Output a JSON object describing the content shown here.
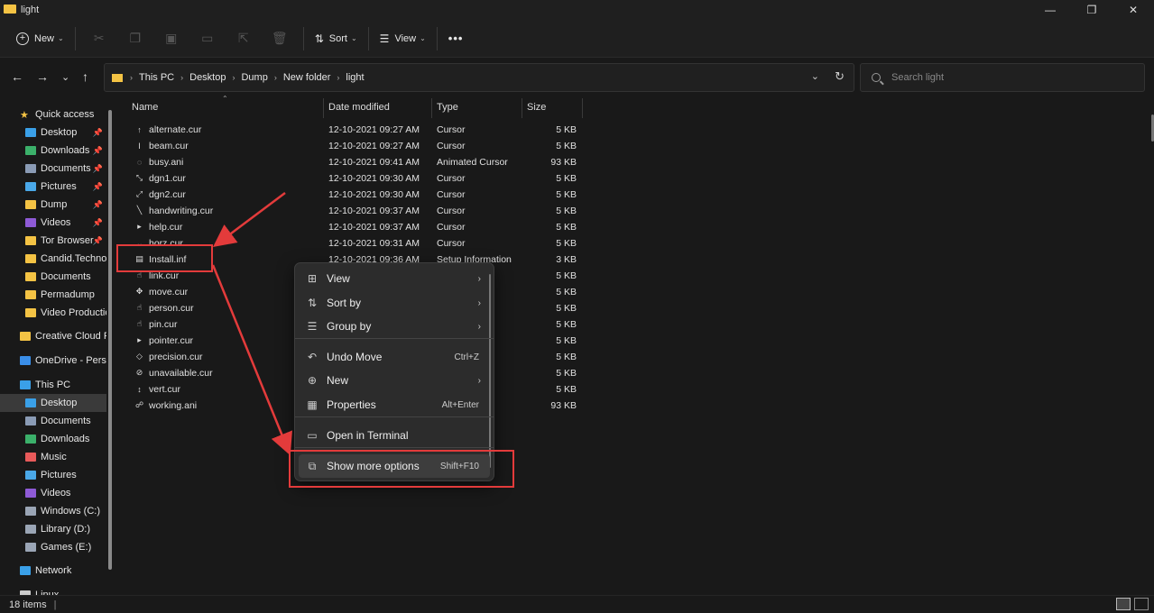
{
  "window": {
    "title": "light"
  },
  "toolbar": {
    "new_label": "New",
    "sort_label": "Sort",
    "view_label": "View",
    "more_label": "•••"
  },
  "address": {
    "crumbs": [
      "This PC",
      "Desktop",
      "Dump",
      "New folder",
      "light"
    ]
  },
  "search": {
    "placeholder": "Search light"
  },
  "sidebar": {
    "items": [
      {
        "label": "Quick access",
        "icon": "star-icon",
        "color": "#f4c344",
        "pinned": false
      },
      {
        "label": "Desktop",
        "icon": "desktop-icon",
        "color": "#3aa0e8",
        "pinned": true
      },
      {
        "label": "Downloads",
        "icon": "download-icon",
        "color": "#3bb06a",
        "pinned": true
      },
      {
        "label": "Documents",
        "icon": "documents-icon",
        "color": "#8a9bb5",
        "pinned": true
      },
      {
        "label": "Pictures",
        "icon": "pictures-icon",
        "color": "#4aa8e8",
        "pinned": true
      },
      {
        "label": "Dump",
        "icon": "folder-icon",
        "color": "#f4c344",
        "pinned": true
      },
      {
        "label": "Videos",
        "icon": "videos-icon",
        "color": "#8e5ad6",
        "pinned": true
      },
      {
        "label": "Tor Browser",
        "icon": "folder-icon",
        "color": "#f4c344",
        "pinned": true
      },
      {
        "label": "Candid.Technolo",
        "icon": "folder-icon",
        "color": "#f4c344",
        "pinned": false
      },
      {
        "label": "Documents",
        "icon": "folder-icon",
        "color": "#f4c344",
        "pinned": false
      },
      {
        "label": "Permadump",
        "icon": "folder-icon",
        "color": "#f4c344",
        "pinned": false
      },
      {
        "label": "Video Productio",
        "icon": "folder-icon",
        "color": "#f4c344",
        "pinned": false
      },
      {
        "label": "Creative Cloud Fil",
        "icon": "creative-cloud-icon",
        "color": "#f4c344",
        "pinned": false
      },
      {
        "label": "OneDrive - Persor",
        "icon": "onedrive-icon",
        "color": "#3a8ee8",
        "pinned": false
      },
      {
        "label": "This PC",
        "icon": "computer-icon",
        "color": "#3aa0e8",
        "pinned": false
      },
      {
        "label": "Desktop",
        "icon": "desktop-icon",
        "color": "#3aa0e8",
        "pinned": false
      },
      {
        "label": "Documents",
        "icon": "documents-icon",
        "color": "#8a9bb5",
        "pinned": false
      },
      {
        "label": "Downloads",
        "icon": "download-icon",
        "color": "#3bb06a",
        "pinned": false
      },
      {
        "label": "Music",
        "icon": "music-icon",
        "color": "#e85a5a",
        "pinned": false
      },
      {
        "label": "Pictures",
        "icon": "pictures-icon",
        "color": "#4aa8e8",
        "pinned": false
      },
      {
        "label": "Videos",
        "icon": "videos-icon",
        "color": "#8e5ad6",
        "pinned": false
      },
      {
        "label": "Windows (C:)",
        "icon": "drive-icon",
        "color": "#9aa5b5",
        "pinned": false
      },
      {
        "label": "Library (D:)",
        "icon": "drive-icon",
        "color": "#9aa5b5",
        "pinned": false
      },
      {
        "label": "Games (E:)",
        "icon": "drive-icon",
        "color": "#9aa5b5",
        "pinned": false
      },
      {
        "label": "Network",
        "icon": "network-icon",
        "color": "#3aa0e8",
        "pinned": false
      },
      {
        "label": "Linux",
        "icon": "linux-icon",
        "color": "#cccccc",
        "pinned": false
      }
    ],
    "selected_label": "Desktop"
  },
  "columns": {
    "name": "Name",
    "date": "Date modified",
    "type": "Type",
    "size": "Size"
  },
  "files": [
    {
      "name": "alternate.cur",
      "date": "12-10-2021 09:27 AM",
      "type": "Cursor",
      "size": "5 KB",
      "glyph": "↑"
    },
    {
      "name": "beam.cur",
      "date": "12-10-2021 09:27 AM",
      "type": "Cursor",
      "size": "5 KB",
      "glyph": "I"
    },
    {
      "name": "busy.ani",
      "date": "12-10-2021 09:41 AM",
      "type": "Animated Cursor",
      "size": "93 KB",
      "glyph": "◌"
    },
    {
      "name": "dgn1.cur",
      "date": "12-10-2021 09:30 AM",
      "type": "Cursor",
      "size": "5 KB",
      "glyph": "⤡"
    },
    {
      "name": "dgn2.cur",
      "date": "12-10-2021 09:30 AM",
      "type": "Cursor",
      "size": "5 KB",
      "glyph": "⤢"
    },
    {
      "name": "handwriting.cur",
      "date": "12-10-2021 09:37 AM",
      "type": "Cursor",
      "size": "5 KB",
      "glyph": "╲"
    },
    {
      "name": "help.cur",
      "date": "12-10-2021 09:37 AM",
      "type": "Cursor",
      "size": "5 KB",
      "glyph": "▸"
    },
    {
      "name": "horz.cur",
      "date": "12-10-2021 09:31 AM",
      "type": "Cursor",
      "size": "5 KB",
      "glyph": "↔"
    },
    {
      "name": "Install.inf",
      "date": "12-10-2021 09:36 AM",
      "type": "Setup Information",
      "size": "3 KB",
      "glyph": "▤"
    },
    {
      "name": "link.cur",
      "date": "",
      "type": "",
      "size": "5 KB",
      "glyph": "☝"
    },
    {
      "name": "move.cur",
      "date": "",
      "type": "",
      "size": "5 KB",
      "glyph": "✥"
    },
    {
      "name": "person.cur",
      "date": "",
      "type": "",
      "size": "5 KB",
      "glyph": "☝"
    },
    {
      "name": "pin.cur",
      "date": "",
      "type": "",
      "size": "5 KB",
      "glyph": "☝"
    },
    {
      "name": "pointer.cur",
      "date": "",
      "type": "",
      "size": "5 KB",
      "glyph": "▸"
    },
    {
      "name": "precision.cur",
      "date": "",
      "type": "",
      "size": "5 KB",
      "glyph": "◇"
    },
    {
      "name": "unavailable.cur",
      "date": "",
      "type": "",
      "size": "5 KB",
      "glyph": "⊘"
    },
    {
      "name": "vert.cur",
      "date": "",
      "type": "",
      "size": "5 KB",
      "glyph": "↕"
    },
    {
      "name": "working.ani",
      "date": "",
      "type": "or",
      "size": "93 KB",
      "glyph": "☍"
    }
  ],
  "context_menu": {
    "items": [
      {
        "label": "View",
        "icon": "grid-icon",
        "glyph": "⊞",
        "shortcut": "",
        "submenu": true
      },
      {
        "label": "Sort by",
        "icon": "sort-icon",
        "glyph": "⇅",
        "shortcut": "",
        "submenu": true
      },
      {
        "label": "Group by",
        "icon": "group-icon",
        "glyph": "☰",
        "shortcut": "",
        "submenu": true
      },
      {
        "label": "Undo Move",
        "icon": "undo-icon",
        "glyph": "↶",
        "shortcut": "Ctrl+Z",
        "submenu": false
      },
      {
        "label": "New",
        "icon": "plus-icon",
        "glyph": "⊕",
        "shortcut": "",
        "submenu": true
      },
      {
        "label": "Properties",
        "icon": "properties-icon",
        "glyph": "▦",
        "shortcut": "Alt+Enter",
        "submenu": false
      },
      {
        "label": "Open in Terminal",
        "icon": "terminal-icon",
        "glyph": "▭",
        "shortcut": "",
        "submenu": false
      },
      {
        "label": "Show more options",
        "icon": "more-options-icon",
        "glyph": "⧉",
        "shortcut": "Shift+F10",
        "submenu": false
      }
    ]
  },
  "status": {
    "item_count": "18 items"
  },
  "colors": {
    "annotation": "#e33b3b",
    "folder": "#f4c344",
    "background": "#191919"
  }
}
